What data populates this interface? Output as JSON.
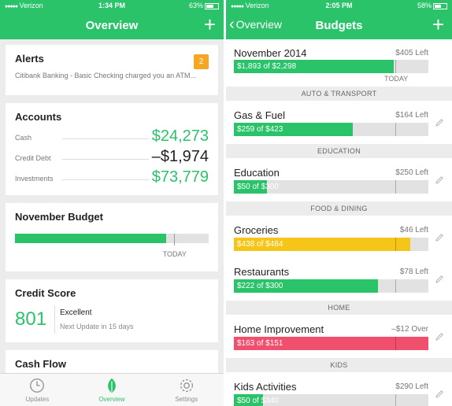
{
  "left": {
    "status": {
      "carrier": "Verizon",
      "time": "1:34 PM",
      "battery": "63%",
      "battery_level": 0.63
    },
    "nav": {
      "title": "Overview"
    },
    "alerts": {
      "title": "Alerts",
      "badge": "2",
      "text": "Citibank Banking - Basic Checking charged you an ATM..."
    },
    "accounts": {
      "title": "Accounts",
      "rows": [
        {
          "label": "Cash",
          "value": "$24,273",
          "color": "green"
        },
        {
          "label": "Credit Debt",
          "value": "–$1,974",
          "color": "dark"
        },
        {
          "label": "Investments",
          "value": "$73,779",
          "color": "green"
        }
      ]
    },
    "budget": {
      "title": "November Budget",
      "today_label": "TODAY",
      "progress": 0.78,
      "today_position": 0.82
    },
    "credit": {
      "title": "Credit Score",
      "score": "801",
      "status": "Excellent",
      "next": "Next Update in 15 days"
    },
    "cashflow": {
      "title": "Cash Flow"
    },
    "tabs": [
      {
        "label": "Updates",
        "icon": "clock-icon",
        "active": false
      },
      {
        "label": "Overview",
        "icon": "leaf-icon",
        "active": true
      },
      {
        "label": "Settings",
        "icon": "gear-icon",
        "active": false
      }
    ]
  },
  "right": {
    "status": {
      "carrier": "Verizon",
      "time": "2:05 PM",
      "battery": "58%",
      "battery_level": 0.58
    },
    "nav": {
      "title": "Budgets",
      "back": "Overview"
    },
    "month": {
      "name": "November 2014",
      "left": "$405 Left",
      "bar_label": "$1,893 of $2,298",
      "progress": 0.82,
      "today_label": "TODAY"
    },
    "sections": [
      "AUTO & TRANSPORT",
      "EDUCATION",
      "FOOD & DINING",
      "HOME",
      "KIDS"
    ],
    "items": [
      {
        "name": "Gas & Fuel",
        "left": "$164 Left",
        "bar_label": "$259 of $423",
        "progress": 0.61,
        "color": "#2ac36a"
      },
      {
        "name": "Education",
        "left": "$250 Left",
        "bar_label": "$50 of $300",
        "progress": 0.17,
        "color": "#2ac36a"
      },
      {
        "name": "Groceries",
        "left": "$46 Left",
        "bar_label": "$438 of $484",
        "progress": 0.905,
        "color": "#f5c518"
      },
      {
        "name": "Restaurants",
        "left": "$78 Left",
        "bar_label": "$222 of $300",
        "progress": 0.74,
        "color": "#2ac36a"
      },
      {
        "name": "Home Improvement",
        "left": "–$12 Over",
        "bar_label": "$163 of $151",
        "progress": 1.0,
        "color": "#f0506e"
      },
      {
        "name": "Kids Activities",
        "left": "$290 Left",
        "bar_label": "$50 of $340",
        "progress": 0.15,
        "color": "#2ac36a"
      }
    ],
    "today_position": 0.83
  }
}
